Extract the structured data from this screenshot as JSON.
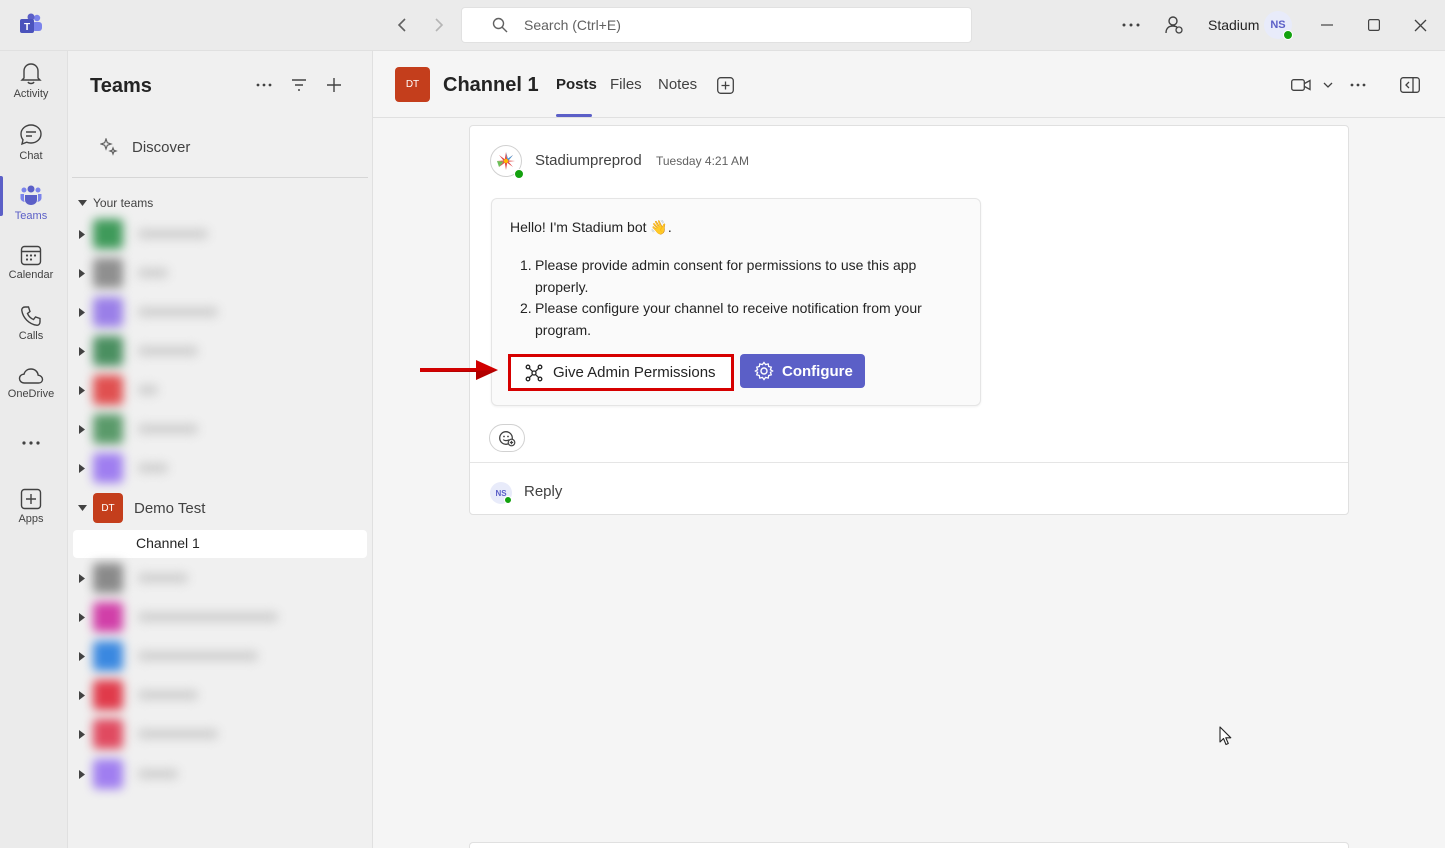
{
  "titlebar": {
    "search_placeholder": "Search (Ctrl+E)",
    "org_name": "Stadium",
    "user_initials": "NS"
  },
  "rail": {
    "items": [
      {
        "label": "Activity"
      },
      {
        "label": "Chat"
      },
      {
        "label": "Teams"
      },
      {
        "label": "Calendar"
      },
      {
        "label": "Calls"
      },
      {
        "label": "OneDrive"
      },
      {
        "label": "Apps"
      }
    ]
  },
  "teams_pane": {
    "title": "Teams",
    "discover": "Discover",
    "section": "Your teams",
    "demo_team": {
      "initials": "DT",
      "name": "Demo Test"
    },
    "selected_channel": "Channel 1"
  },
  "channel": {
    "initials": "DT",
    "title": "Channel 1",
    "tabs": [
      {
        "label": "Posts"
      },
      {
        "label": "Files"
      },
      {
        "label": "Notes"
      }
    ]
  },
  "message": {
    "sender": "Stadiumpreprod",
    "timestamp": "Tuesday 4:21 AM",
    "greeting": "Hello! I'm Stadium bot 👋.",
    "list": [
      {
        "num": "1.",
        "text": "Please provide admin consent for permissions to use this app properly."
      },
      {
        "num": "2.",
        "text": "Please configure your channel to receive notification from your program."
      }
    ],
    "buttons": {
      "give_admin": "Give Admin Permissions",
      "configure": "Configure"
    },
    "reply_initials": "NS",
    "reply_label": "Reply"
  },
  "colors": {
    "accent": "#5b5fc7",
    "team_orange": "#c43e1c",
    "highlight_red": "#d60000",
    "presence_green": "#13a10e"
  }
}
